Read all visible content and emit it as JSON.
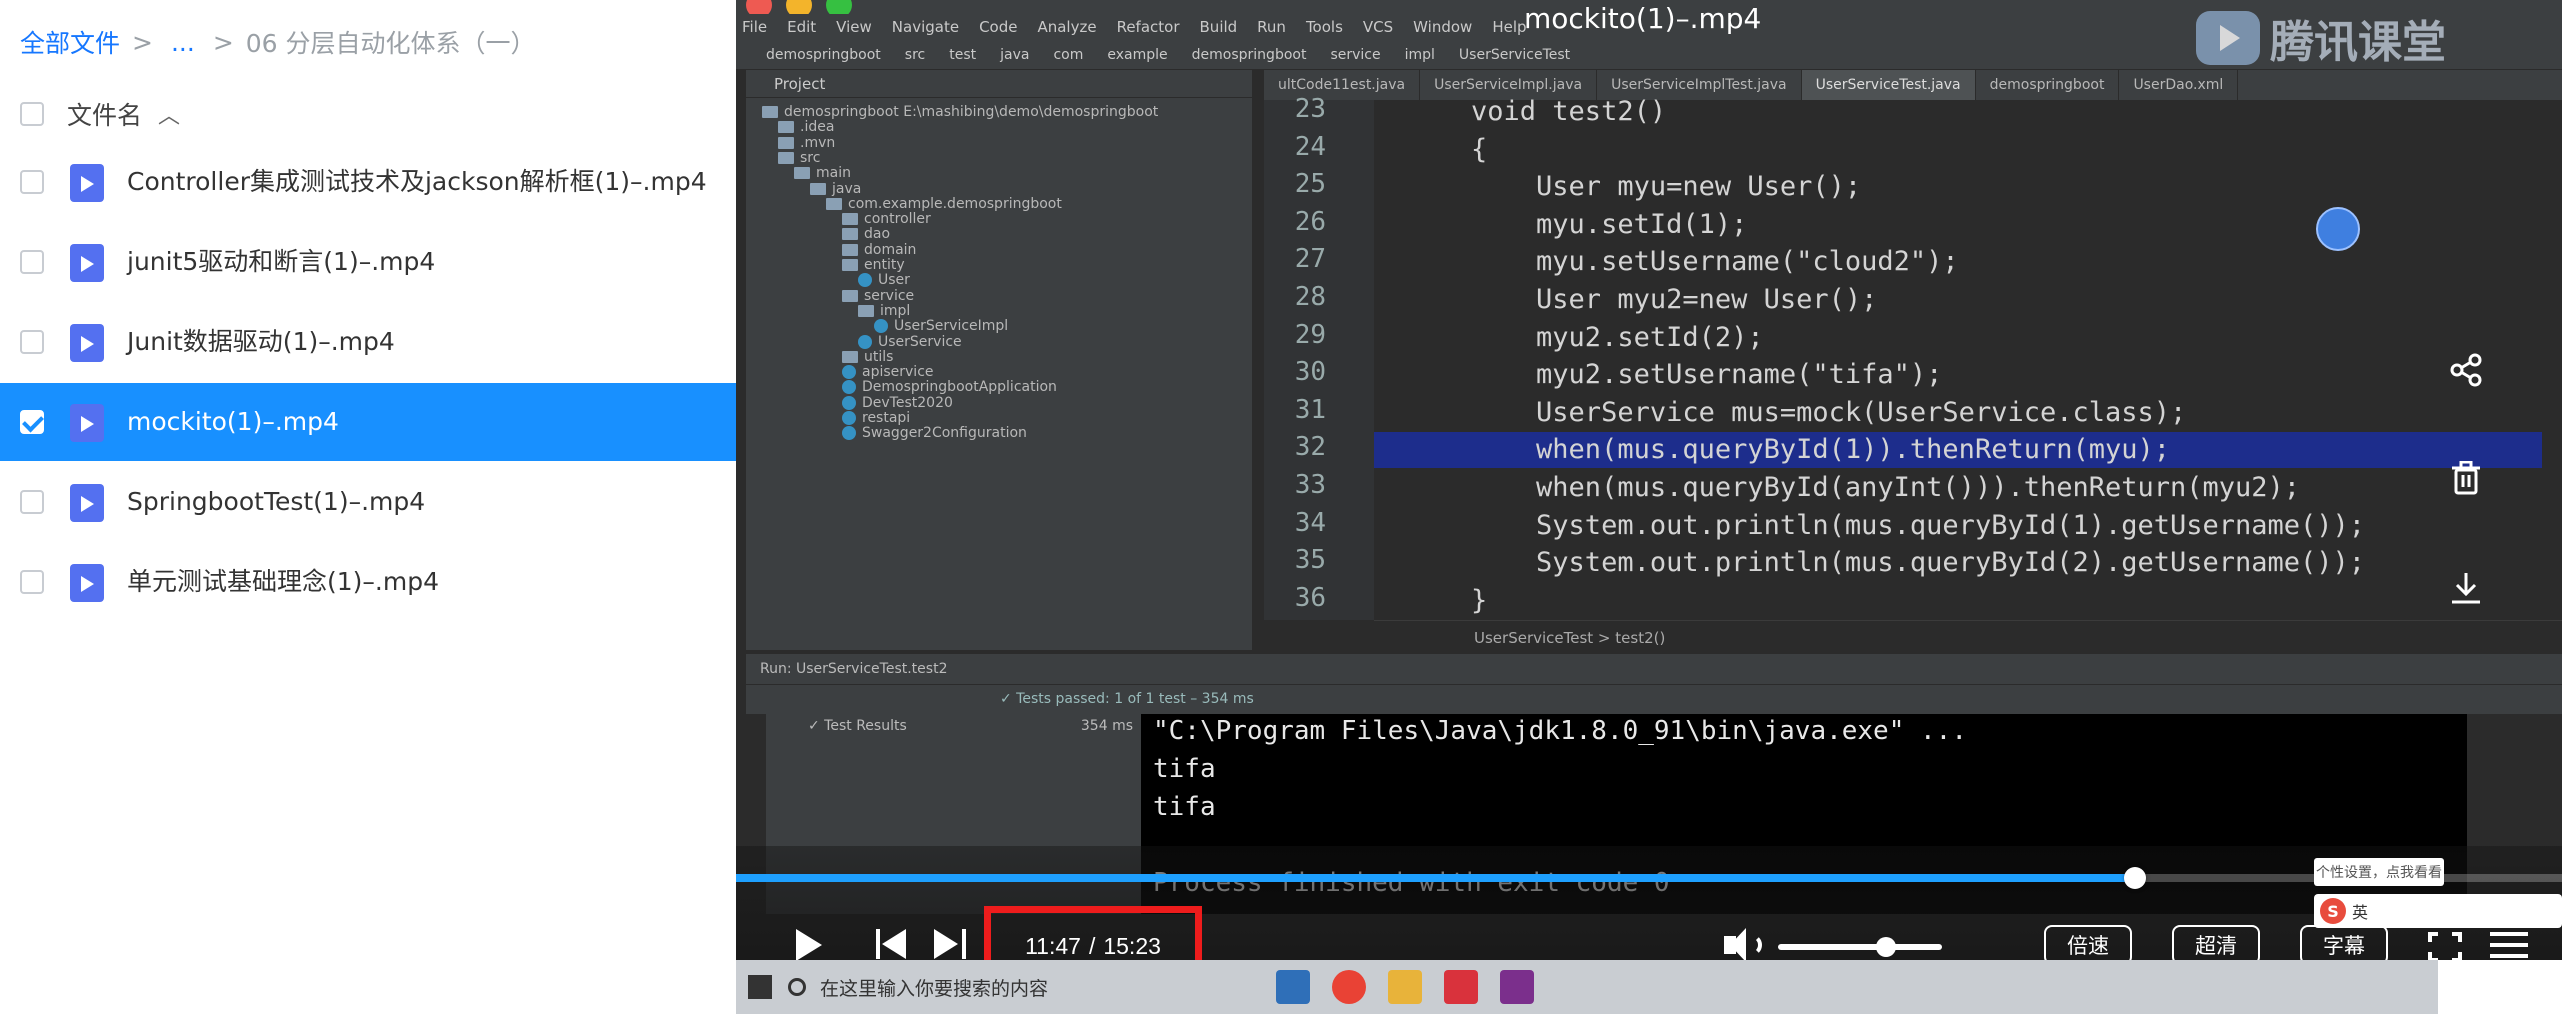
{
  "breadcrumb": {
    "root": "全部文件",
    "ellipsis": "...",
    "current": "06 分层自动化体系（一）"
  },
  "list_header": {
    "column_label": "文件名",
    "sort_indicator": "^"
  },
  "files": [
    {
      "name": "Controller集成测试技术及jackson解析框(1)–.mp4",
      "selected": false
    },
    {
      "name": "junit5驱动和断言(1)–.mp4",
      "selected": false
    },
    {
      "name": "Junit数据驱动(1)–.mp4",
      "selected": false
    },
    {
      "name": "mockito(1)–.mp4",
      "selected": true
    },
    {
      "name": "SpringbootTest(1)–.mp4",
      "selected": false
    },
    {
      "name": "单元测试基础理念(1)–.mp4",
      "selected": false
    }
  ],
  "player": {
    "title": "mockito(1)–.mp4",
    "brand_text": "腾讯课堂",
    "time_current": "11:47",
    "time_separator": "/",
    "time_total": "15:23",
    "progress_fraction": 0.766,
    "volume_fraction": 0.66,
    "speed_label": "倍速",
    "quality_label": "超清",
    "subtitle_label": "字幕",
    "icons": {
      "share": "share-icon",
      "delete": "trash-icon",
      "download": "download-icon",
      "play": "play-icon",
      "prev": "skip-previous-icon",
      "next": "skip-next-icon",
      "volume": "volume-icon",
      "fullscreen": "fullscreen-icon",
      "playlist": "playlist-icon"
    },
    "colors": {
      "progress": "#1ea0ff",
      "time_highlight": "#ee1c1c",
      "selection": "#1890ff"
    }
  },
  "ide": {
    "menu": [
      "File",
      "Edit",
      "View",
      "Navigate",
      "Code",
      "Analyze",
      "Refactor",
      "Build",
      "Run",
      "Tools",
      "VCS",
      "Window",
      "Help"
    ],
    "nav_path": [
      "demospringboot",
      "src",
      "test",
      "java",
      "com",
      "example",
      "demospringboot",
      "service",
      "impl",
      "UserServiceTest"
    ],
    "project_label": "Project",
    "tabs": [
      {
        "label": "ultCode11est.java",
        "active": false
      },
      {
        "label": "UserServiceImpl.java",
        "active": false
      },
      {
        "label": "UserServiceImplTest.java",
        "active": false
      },
      {
        "label": "UserServiceTest.java",
        "active": true
      },
      {
        "label": "demospringboot",
        "active": false
      },
      {
        "label": "UserDao.xml",
        "active": false
      }
    ],
    "tree": [
      {
        "label": "demospringboot  E:\\mashibing\\demo\\demospringboot",
        "depth": 0,
        "kind": "folder"
      },
      {
        "label": ".idea",
        "depth": 1,
        "kind": "folder"
      },
      {
        "label": ".mvn",
        "depth": 1,
        "kind": "folder"
      },
      {
        "label": "src",
        "depth": 1,
        "kind": "folder"
      },
      {
        "label": "main",
        "depth": 2,
        "kind": "folder"
      },
      {
        "label": "java",
        "depth": 3,
        "kind": "folder"
      },
      {
        "label": "com.example.demospringboot",
        "depth": 4,
        "kind": "folder"
      },
      {
        "label": "controller",
        "depth": 5,
        "kind": "folder"
      },
      {
        "label": "dao",
        "depth": 5,
        "kind": "folder"
      },
      {
        "label": "domain",
        "depth": 5,
        "kind": "folder"
      },
      {
        "label": "entity",
        "depth": 5,
        "kind": "folder"
      },
      {
        "label": "User",
        "depth": 6,
        "kind": "class"
      },
      {
        "label": "service",
        "depth": 5,
        "kind": "folder"
      },
      {
        "label": "impl",
        "depth": 6,
        "kind": "folder"
      },
      {
        "label": "UserServiceImpl",
        "depth": 7,
        "kind": "class"
      },
      {
        "label": "UserService",
        "depth": 6,
        "kind": "class"
      },
      {
        "label": "utils",
        "depth": 5,
        "kind": "folder"
      },
      {
        "label": "apiservice",
        "depth": 5,
        "kind": "class"
      },
      {
        "label": "DemospringbootApplication",
        "depth": 5,
        "kind": "class"
      },
      {
        "label": "DevTest2020",
        "depth": 5,
        "kind": "class"
      },
      {
        "label": "restapi",
        "depth": 5,
        "kind": "class"
      },
      {
        "label": "Swagger2Configuration",
        "depth": 5,
        "kind": "class"
      }
    ],
    "code_lines": [
      {
        "no": "23",
        "text": "    void test2()"
      },
      {
        "no": "24",
        "text": "    {"
      },
      {
        "no": "25",
        "text": "        User myu=new User();"
      },
      {
        "no": "26",
        "text": "        myu.setId(1);"
      },
      {
        "no": "27",
        "text": "        myu.setUsername(\"cloud2\");"
      },
      {
        "no": "28",
        "text": "        User myu2=new User();"
      },
      {
        "no": "29",
        "text": "        myu2.setId(2);"
      },
      {
        "no": "30",
        "text": "        myu2.setUsername(\"tifa\");"
      },
      {
        "no": "31",
        "text": "        UserService mus=mock(UserService.class);"
      },
      {
        "no": "32",
        "text": "        when(mus.queryById(1)).thenReturn(myu);"
      },
      {
        "no": "33",
        "text": "        when(mus.queryById(anyInt())).thenReturn(myu2);"
      },
      {
        "no": "34",
        "text": "        System.out.println(mus.queryById(1).getUsername());"
      },
      {
        "no": "35",
        "text": "        System.out.println(mus.queryById(2).getUsername());"
      },
      {
        "no": "36",
        "text": "    }"
      }
    ],
    "highlighted_line": "32",
    "editor_crumb": "UserServiceTest  >  test2()",
    "run_tab": "Run:   UserServiceTest.test2",
    "tests_passed": "✓ Tests passed: 1 of 1 test – 354 ms",
    "test_results": "✓ Test Results",
    "test_time": "354 ms",
    "console_lines": [
      "\"C:\\Program Files\\Java\\jdk1.8.0_91\\bin\\java.exe\" ...",
      "tifa",
      "tifa",
      "Process finished with exit code 0"
    ]
  },
  "taskbar": {
    "search_placeholder": "在这里输入你要搜索的内容"
  },
  "overlay": {
    "tooltip": "个性设置，点我看看",
    "ime_label": "英"
  }
}
